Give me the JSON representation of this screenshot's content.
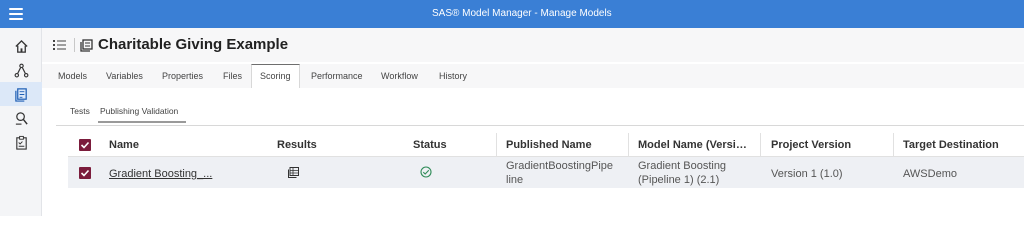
{
  "app": {
    "title": "SAS® Model Manager - Manage Models"
  },
  "nav": {
    "icons": [
      "home-icon",
      "pipeline-icon",
      "models-icon",
      "search-icon",
      "tasks-icon"
    ],
    "active": "models-icon"
  },
  "header": {
    "title": "Charitable Giving Example"
  },
  "tabs": [
    "Models",
    "Variables",
    "Properties",
    "Files",
    "Scoring",
    "Performance",
    "Workflow",
    "History"
  ],
  "active_tab": "Scoring",
  "subtabs": [
    "Tests",
    "Publishing Validation"
  ],
  "active_subtab": "Publishing Validation",
  "table": {
    "headers": {
      "name": "Name",
      "results": "Results",
      "status": "Status",
      "published_name": "Published Name",
      "model_name": "Model Name (Versi…",
      "project_version": "Project Version",
      "target_destination": "Target Destination"
    },
    "rows": [
      {
        "checked": true,
        "name": "Gradient Boosting_...",
        "results_icon": "results-table-icon",
        "status_icon": "success-check-icon",
        "published_name_line1": "GradientBoostingPipe",
        "published_name_line2": "line",
        "model_name_line1": "Gradient Boosting",
        "model_name_line2": "(Pipeline 1) (2.1)",
        "project_version": "Version 1 (1.0)",
        "target_destination": "AWSDemo"
      }
    ]
  },
  "colors": {
    "topbar": "#3a7fd5",
    "checkbox": "#7b1c3c",
    "success": "#2e8b57",
    "active_nav": "#dce8f8"
  }
}
